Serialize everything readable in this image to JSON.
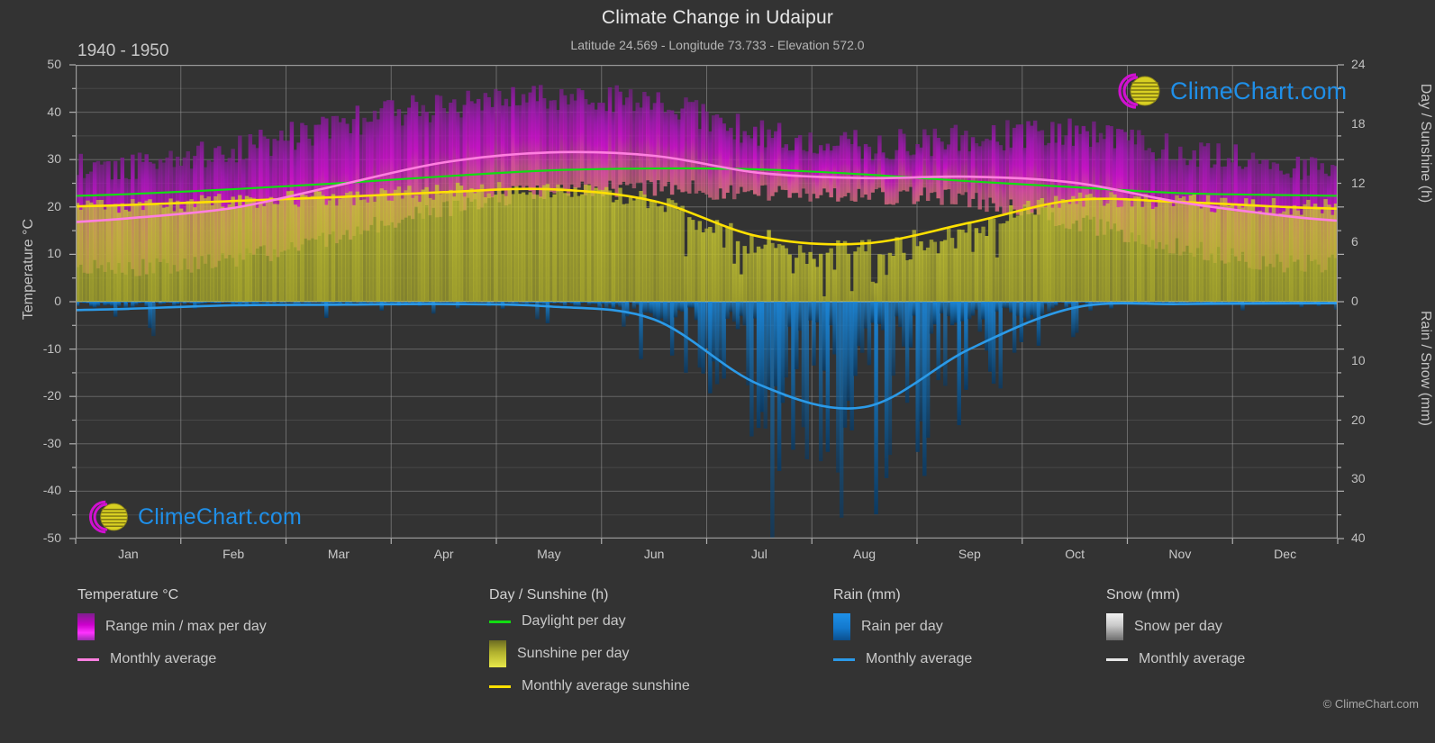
{
  "header": {
    "title": "Climate Change in Udaipur",
    "subtitle": "Latitude 24.569 - Longitude 73.733 - Elevation 572.0",
    "period": "1940 - 1950"
  },
  "axes": {
    "left_title": "Temperature °C",
    "right_title_top": "Day / Sunshine (h)",
    "right_title_bottom": "Rain / Snow (mm)",
    "left_ticks": [
      "50",
      "40",
      "30",
      "20",
      "10",
      "0",
      "-10",
      "-20",
      "-30",
      "-40",
      "-50"
    ],
    "right_ticks_top": [
      "24",
      "18",
      "12",
      "6",
      "0"
    ],
    "right_ticks_bottom": [
      "0",
      "10",
      "20",
      "30",
      "40"
    ],
    "x_ticks": [
      "Jan",
      "Feb",
      "Mar",
      "Apr",
      "May",
      "Jun",
      "Jul",
      "Aug",
      "Sep",
      "Oct",
      "Nov",
      "Dec"
    ]
  },
  "legend": {
    "temperature": {
      "heading": "Temperature °C",
      "items": [
        {
          "label": "Range min / max per day",
          "kind": "box",
          "color": "#cc00cc"
        },
        {
          "label": "Monthly average",
          "kind": "line",
          "color": "#ff7fe0"
        }
      ]
    },
    "day_sunshine": {
      "heading": "Day / Sunshine (h)",
      "items": [
        {
          "label": "Daylight per day",
          "kind": "line",
          "color": "#12dd12"
        },
        {
          "label": "Sunshine per day",
          "kind": "box",
          "color": "#b2b22e"
        },
        {
          "label": "Monthly average sunshine",
          "kind": "line",
          "color": "#ffe000"
        }
      ]
    },
    "rain": {
      "heading": "Rain (mm)",
      "items": [
        {
          "label": "Rain per day",
          "kind": "box",
          "color": "#1378cc"
        },
        {
          "label": "Monthly average",
          "kind": "line",
          "color": "#2b9ae8"
        }
      ]
    },
    "snow": {
      "heading": "Snow (mm)",
      "items": [
        {
          "label": "Snow per day",
          "kind": "box",
          "color": "#c9c9c9"
        },
        {
          "label": "Monthly average",
          "kind": "line",
          "color": "#e6e6e6"
        }
      ]
    }
  },
  "watermark": {
    "text": "ClimeChart.com",
    "copyright": "© ClimeChart.com"
  },
  "chart_data": {
    "type": "area",
    "title": "Climate Change in Udaipur",
    "subtitle": "Latitude 24.569 - Longitude 73.733 - Elevation 572.0",
    "period": "1940 - 1950",
    "xlabel": "",
    "ylabel": "Temperature °C",
    "ylim": [
      -50,
      50
    ],
    "y2_top_label": "Day / Sunshine (h)",
    "y2_top_lim": [
      0,
      24
    ],
    "y2_bottom_label": "Rain / Snow (mm)",
    "y2_bottom_lim": [
      0,
      40
    ],
    "grid": true,
    "legend_position": "below",
    "categories": [
      "Jan",
      "Feb",
      "Mar",
      "Apr",
      "May",
      "Jun",
      "Jul",
      "Aug",
      "Sep",
      "Oct",
      "Nov",
      "Dec"
    ],
    "series": [
      {
        "name": "Monthly average temperature (°C)",
        "unit": "°C",
        "color": "#ff7fe0",
        "values": [
          17.6,
          19.8,
          24.6,
          29.4,
          31.5,
          30.8,
          27.2,
          26.1,
          26.4,
          25.1,
          21.0,
          18.1
        ]
      },
      {
        "name": "Daily max temperature (°C)",
        "unit": "°C",
        "color": "#cc00cc",
        "values": [
          28.5,
          31.5,
          37.0,
          41.0,
          43.0,
          41.5,
          35.0,
          32.5,
          34.0,
          35.0,
          31.5,
          28.5
        ]
      },
      {
        "name": "Daily min temperature (°C)",
        "unit": "°C",
        "color": "#cc00cc",
        "values": [
          7.0,
          9.0,
          14.0,
          19.5,
          23.5,
          24.0,
          23.0,
          22.5,
          21.5,
          17.0,
          11.5,
          8.0
        ]
      },
      {
        "name": "Daylight per day (h)",
        "unit": "h",
        "color": "#12dd12",
        "values": [
          10.9,
          11.4,
          12.0,
          12.7,
          13.3,
          13.5,
          13.4,
          12.9,
          12.2,
          11.6,
          11.0,
          10.8
        ]
      },
      {
        "name": "Monthly average sunshine (h)",
        "unit": "h",
        "color": "#ffe000",
        "values": [
          9.8,
          10.2,
          10.6,
          11.1,
          11.4,
          10.2,
          6.6,
          5.9,
          8.0,
          10.3,
          10.1,
          9.6
        ]
      },
      {
        "name": "Monthly average rain (mm)",
        "unit": "mm",
        "color": "#2b9ae8",
        "values": [
          1.2,
          0.6,
          0.5,
          0.4,
          0.8,
          3.0,
          14.0,
          17.8,
          8.0,
          1.0,
          0.4,
          0.3
        ]
      },
      {
        "name": "Monthly average snow (mm)",
        "unit": "mm",
        "color": "#e6e6e6",
        "values": [
          0,
          0,
          0,
          0,
          0,
          0,
          0,
          0,
          0,
          0,
          0,
          0
        ]
      }
    ]
  }
}
